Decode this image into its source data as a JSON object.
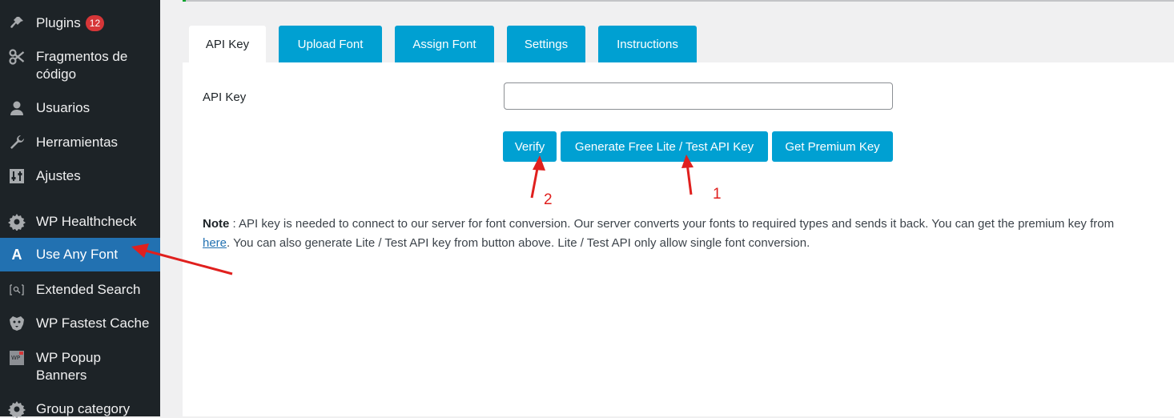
{
  "sidebar": {
    "items": [
      {
        "label": "Plugins",
        "badge": "12",
        "icon": "plugin-icon"
      },
      {
        "label": "Fragmentos de código",
        "line1": "Fragmentos de",
        "line2": "código",
        "icon": "scissors-icon"
      },
      {
        "label": "Usuarios",
        "icon": "user-icon"
      },
      {
        "label": "Herramientas",
        "icon": "wrench-icon"
      },
      {
        "label": "Ajustes",
        "icon": "settings-sliders-icon"
      },
      {
        "label": "WP Healthcheck",
        "icon": "gear-icon"
      },
      {
        "label": "Use Any Font",
        "icon": "letter-a-icon",
        "active": true
      },
      {
        "label": "Extended Search",
        "icon": "search-bracket-icon"
      },
      {
        "label": "WP Fastest Cache",
        "icon": "cheetah-icon"
      },
      {
        "label": "WP Popup Banners",
        "line1": "WP Popup",
        "line2": "Banners",
        "icon": "wp-popup-icon"
      },
      {
        "label": "Group category",
        "icon": "gear-icon"
      }
    ]
  },
  "tabs": [
    {
      "label": "API Key",
      "active": true
    },
    {
      "label": "Upload Font"
    },
    {
      "label": "Assign Font"
    },
    {
      "label": "Settings"
    },
    {
      "label": "Instructions"
    }
  ],
  "form": {
    "api_key_label": "API Key",
    "api_key_value": "",
    "api_key_placeholder": "",
    "buttons": {
      "verify": "Verify",
      "generate": "Generate Free Lite / Test API Key",
      "premium": "Get Premium Key"
    }
  },
  "note": {
    "label": "Note",
    "sep": " : ",
    "line1": "API key is needed to connect to our server for font conversion. Our server converts your fonts to required types and sends it back. You can get the premium key from",
    "link": "here",
    "line2": ". You can also generate Lite / Test API key from button above. Lite / Test API only allow single font conversion."
  },
  "annotations": {
    "one": "1",
    "two": "2"
  },
  "colors": {
    "sidebar_bg": "#1d2327",
    "active_bg": "#2271b1",
    "button_bg": "#00a0d2",
    "badge_bg": "#d63638",
    "annotation": "#e0201e"
  }
}
